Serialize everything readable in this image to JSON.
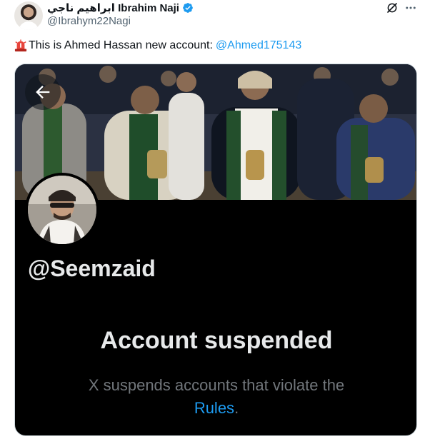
{
  "author": {
    "display_name": "ابراهيم ناجي Ibrahim Naji",
    "handle": "@Ibrahym22Nagi",
    "verified_icon": "verified-badge-icon"
  },
  "tweet": {
    "text_prefix": "This is Ahmed Hassan new account: ",
    "mention": "@Ahmed175143",
    "emoji": "siren-icon"
  },
  "card": {
    "profile_handle": "@Seemzaid",
    "title": "Account suspended",
    "description_line1": "X suspends accounts that violate the",
    "rules_link": "Rules",
    "trailing_period": "."
  },
  "colors": {
    "link": "#1d9bf0",
    "card_bg": "#000000",
    "muted": "#71767b",
    "verified": "#1d9bf0"
  }
}
